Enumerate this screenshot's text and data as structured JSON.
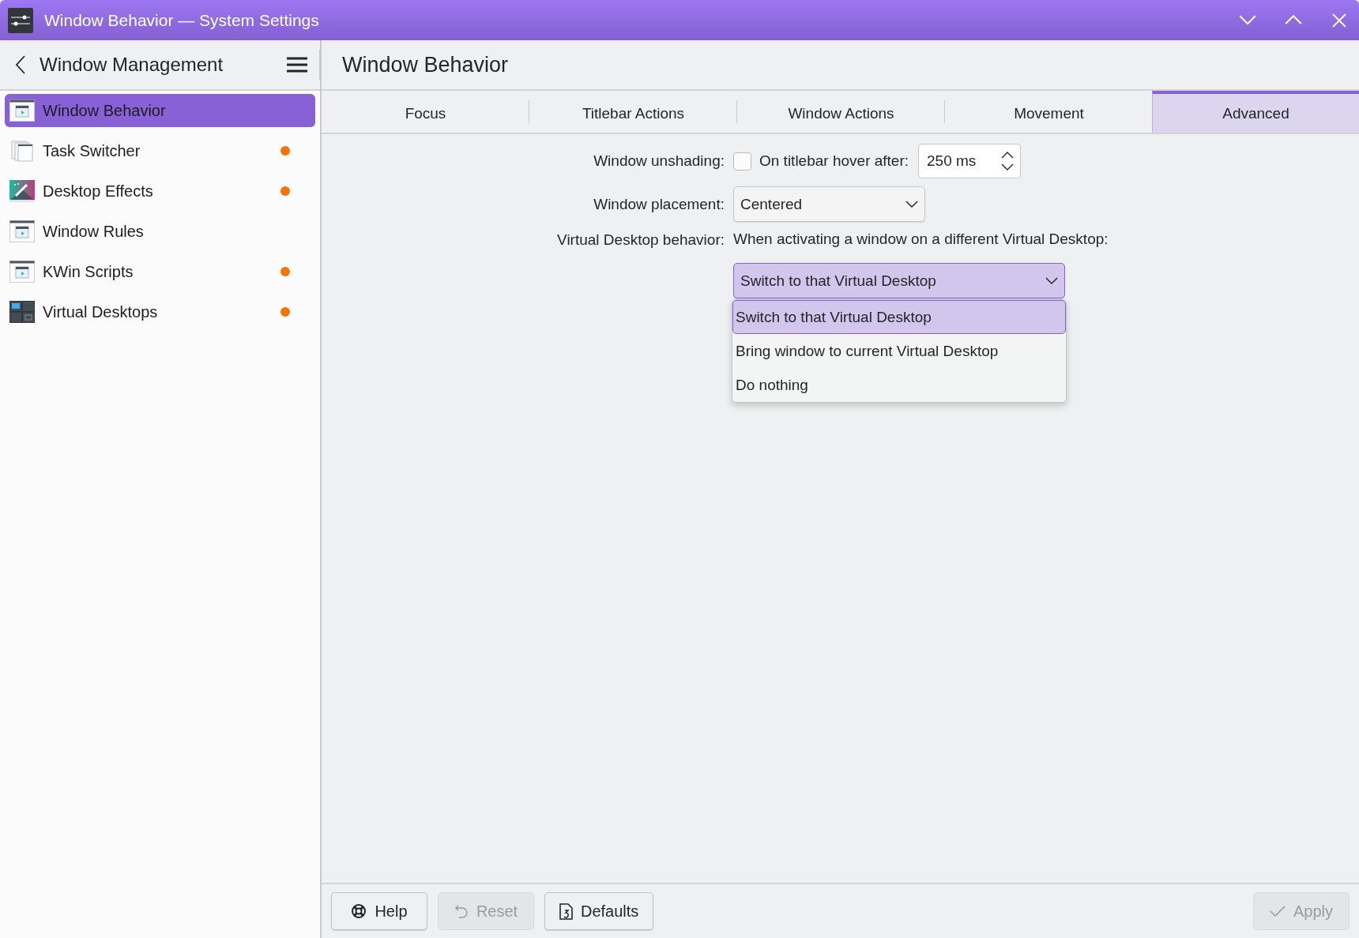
{
  "window": {
    "title": "Window Behavior — System Settings"
  },
  "sidebar": {
    "title": "Window Management",
    "items": [
      {
        "label": "Window Behavior",
        "selected": true,
        "modified": false
      },
      {
        "label": "Task Switcher",
        "selected": false,
        "modified": true
      },
      {
        "label": "Desktop Effects",
        "selected": false,
        "modified": true
      },
      {
        "label": "Window Rules",
        "selected": false,
        "modified": false
      },
      {
        "label": "KWin Scripts",
        "selected": false,
        "modified": true
      },
      {
        "label": "Virtual Desktops",
        "selected": false,
        "modified": true
      }
    ]
  },
  "page_title": "Window Behavior",
  "tabs": [
    {
      "label": "Focus",
      "selected": false
    },
    {
      "label": "Titlebar Actions",
      "selected": false
    },
    {
      "label": "Window Actions",
      "selected": false
    },
    {
      "label": "Movement",
      "selected": false
    },
    {
      "label": "Advanced",
      "selected": true
    }
  ],
  "form": {
    "unshading": {
      "label": "Window unshading:",
      "checkbox": {
        "label": "On titlebar hover after:",
        "checked": false
      },
      "delay": {
        "value": "250 ms"
      }
    },
    "placement": {
      "label": "Window placement:",
      "value": "Centered"
    },
    "virtual_desktop": {
      "label": "Virtual Desktop behavior:",
      "description": "When activating a window on a different Virtual Desktop:",
      "value": "Switch to that Virtual Desktop",
      "expanded": true,
      "options": [
        {
          "label": "Switch to that Virtual Desktop",
          "selected": true
        },
        {
          "label": "Bring window to current Virtual Desktop",
          "selected": false
        },
        {
          "label": "Do nothing",
          "selected": false
        }
      ]
    }
  },
  "footer": {
    "left": [
      {
        "kind": "help",
        "label": "Help",
        "disabled": false
      },
      {
        "kind": "reset",
        "label": "Reset",
        "disabled": true
      },
      {
        "kind": "defaults",
        "label": "Defaults",
        "disabled": false
      }
    ],
    "right": [
      {
        "kind": "apply",
        "label": "Apply",
        "disabled": true
      }
    ]
  }
}
